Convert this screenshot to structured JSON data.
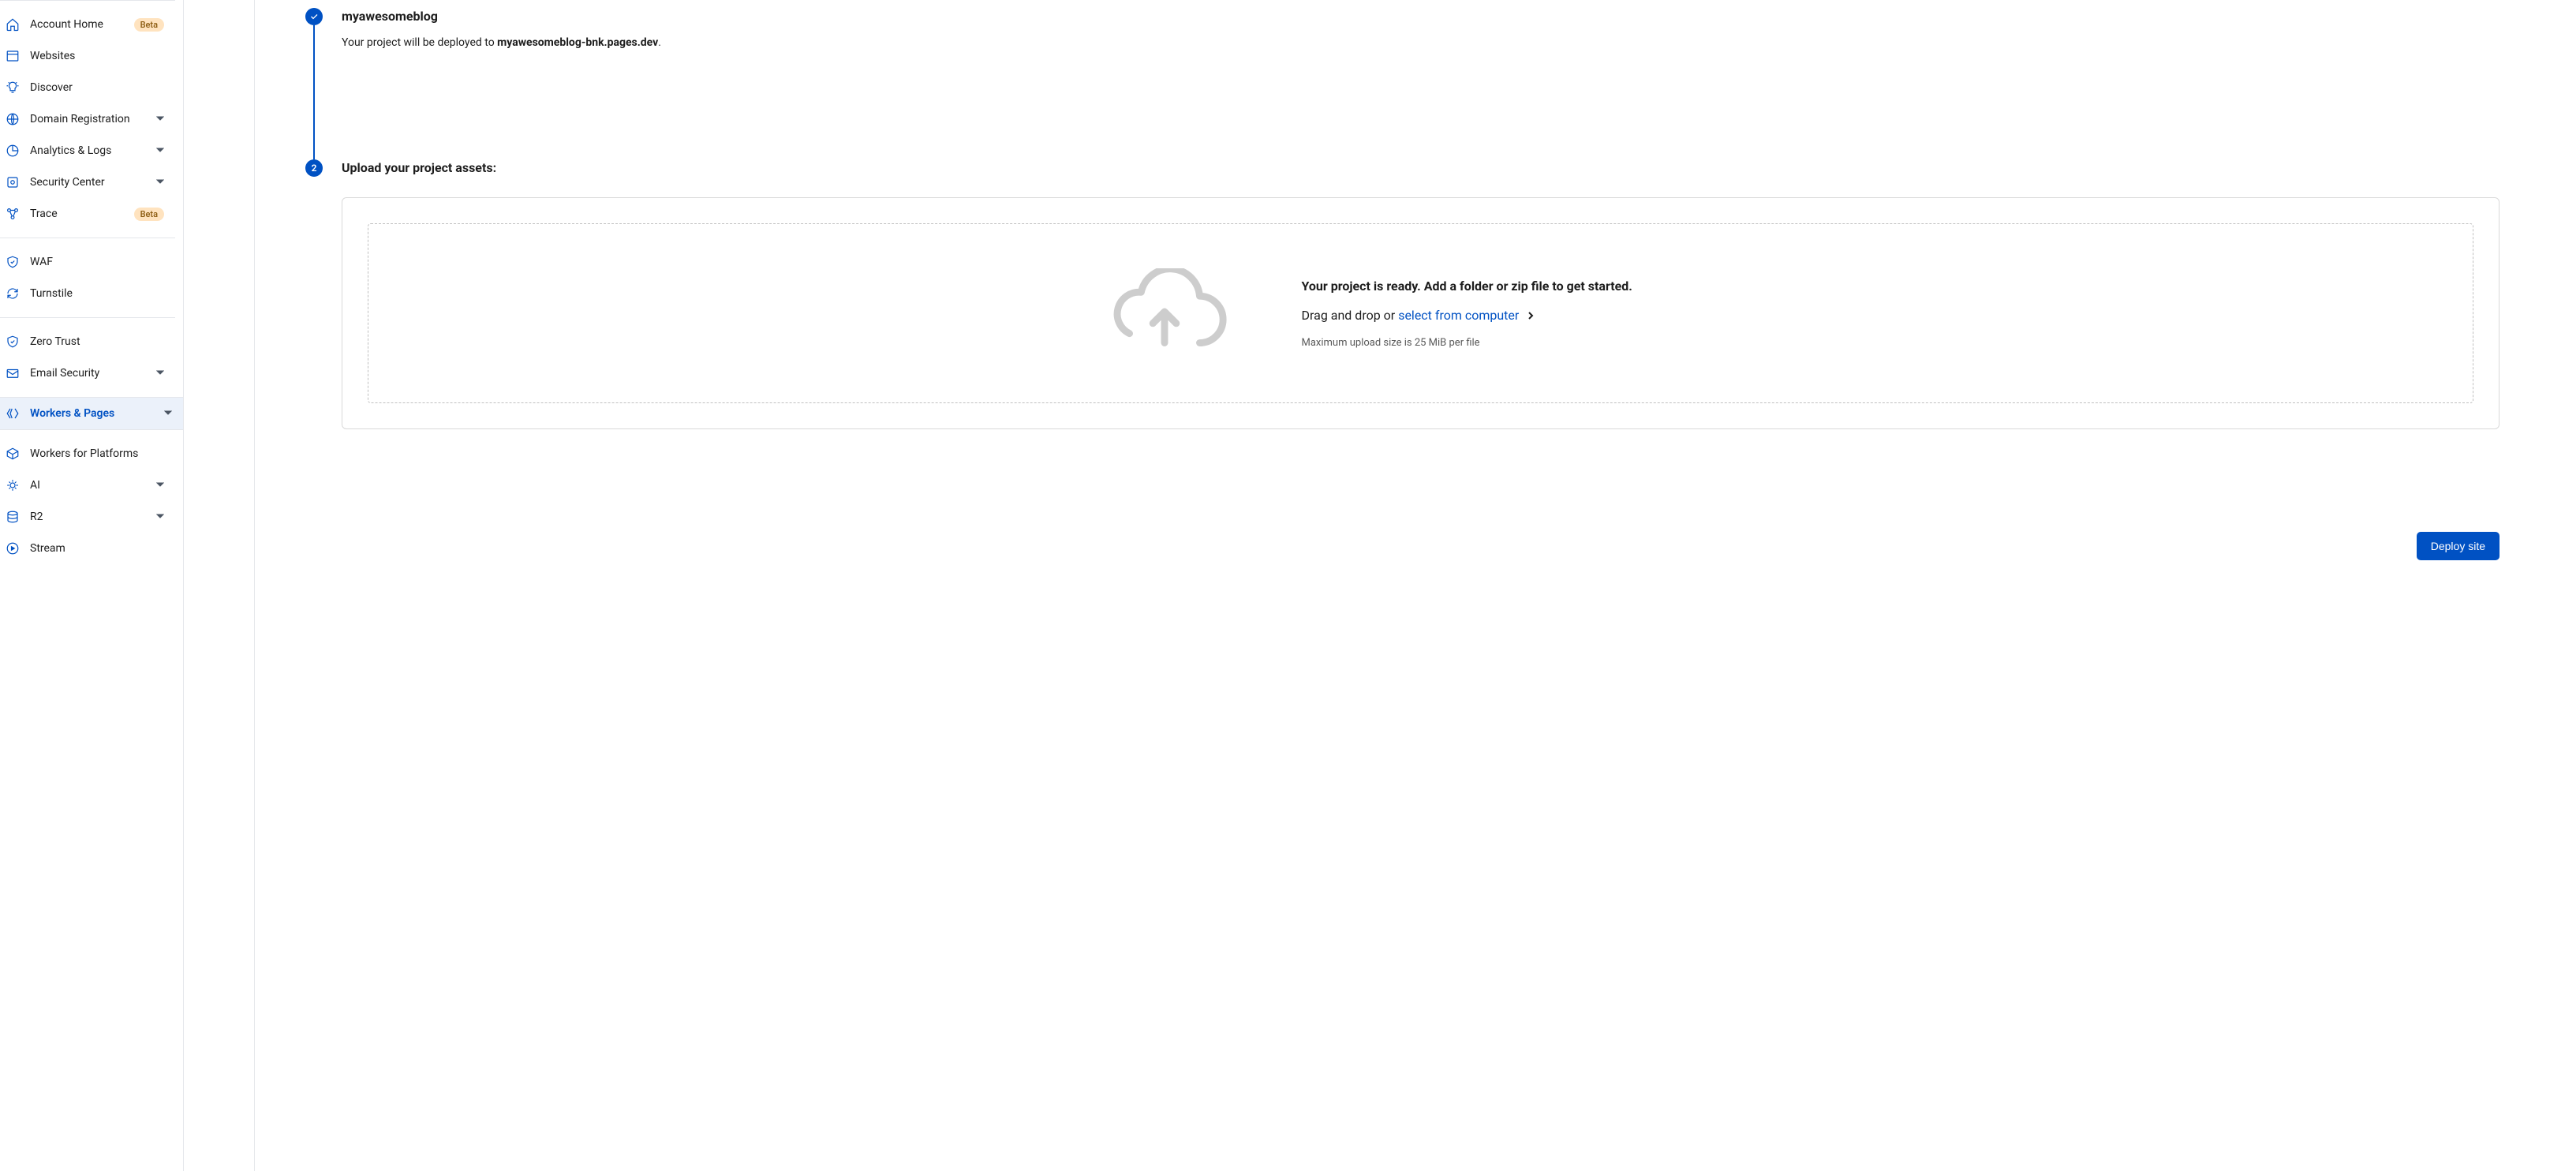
{
  "sidebar": {
    "items": [
      {
        "label": "Account Home",
        "badge": "Beta"
      },
      {
        "label": "Websites"
      },
      {
        "label": "Discover"
      },
      {
        "label": "Domain Registration",
        "expandable": true
      },
      {
        "label": "Analytics & Logs",
        "expandable": true
      },
      {
        "label": "Security Center",
        "expandable": true
      },
      {
        "label": "Trace",
        "badge": "Beta"
      },
      {
        "label": "WAF"
      },
      {
        "label": "Turnstile"
      },
      {
        "label": "Zero Trust"
      },
      {
        "label": "Email Security",
        "expandable": true
      },
      {
        "label": "Workers & Pages",
        "expandable": true,
        "active": true
      },
      {
        "label": "Workers for Platforms"
      },
      {
        "label": "AI",
        "expandable": true
      },
      {
        "label": "R2",
        "expandable": true
      },
      {
        "label": "Stream"
      }
    ]
  },
  "steps": {
    "project": {
      "title": "myawesomeblog",
      "desc_prefix": "Your project will be deployed to ",
      "domain": "myawesomeblog-bnk.pages.dev",
      "desc_suffix": "."
    },
    "upload": {
      "number": "2",
      "title": "Upload your project assets:",
      "heading": "Your project is ready. Add a folder or zip file to get started.",
      "drag_text": "Drag and drop or ",
      "select_link": "select from computer",
      "hint": "Maximum upload size is 25 MiB per file"
    }
  },
  "actions": {
    "deploy": "Deploy site"
  }
}
